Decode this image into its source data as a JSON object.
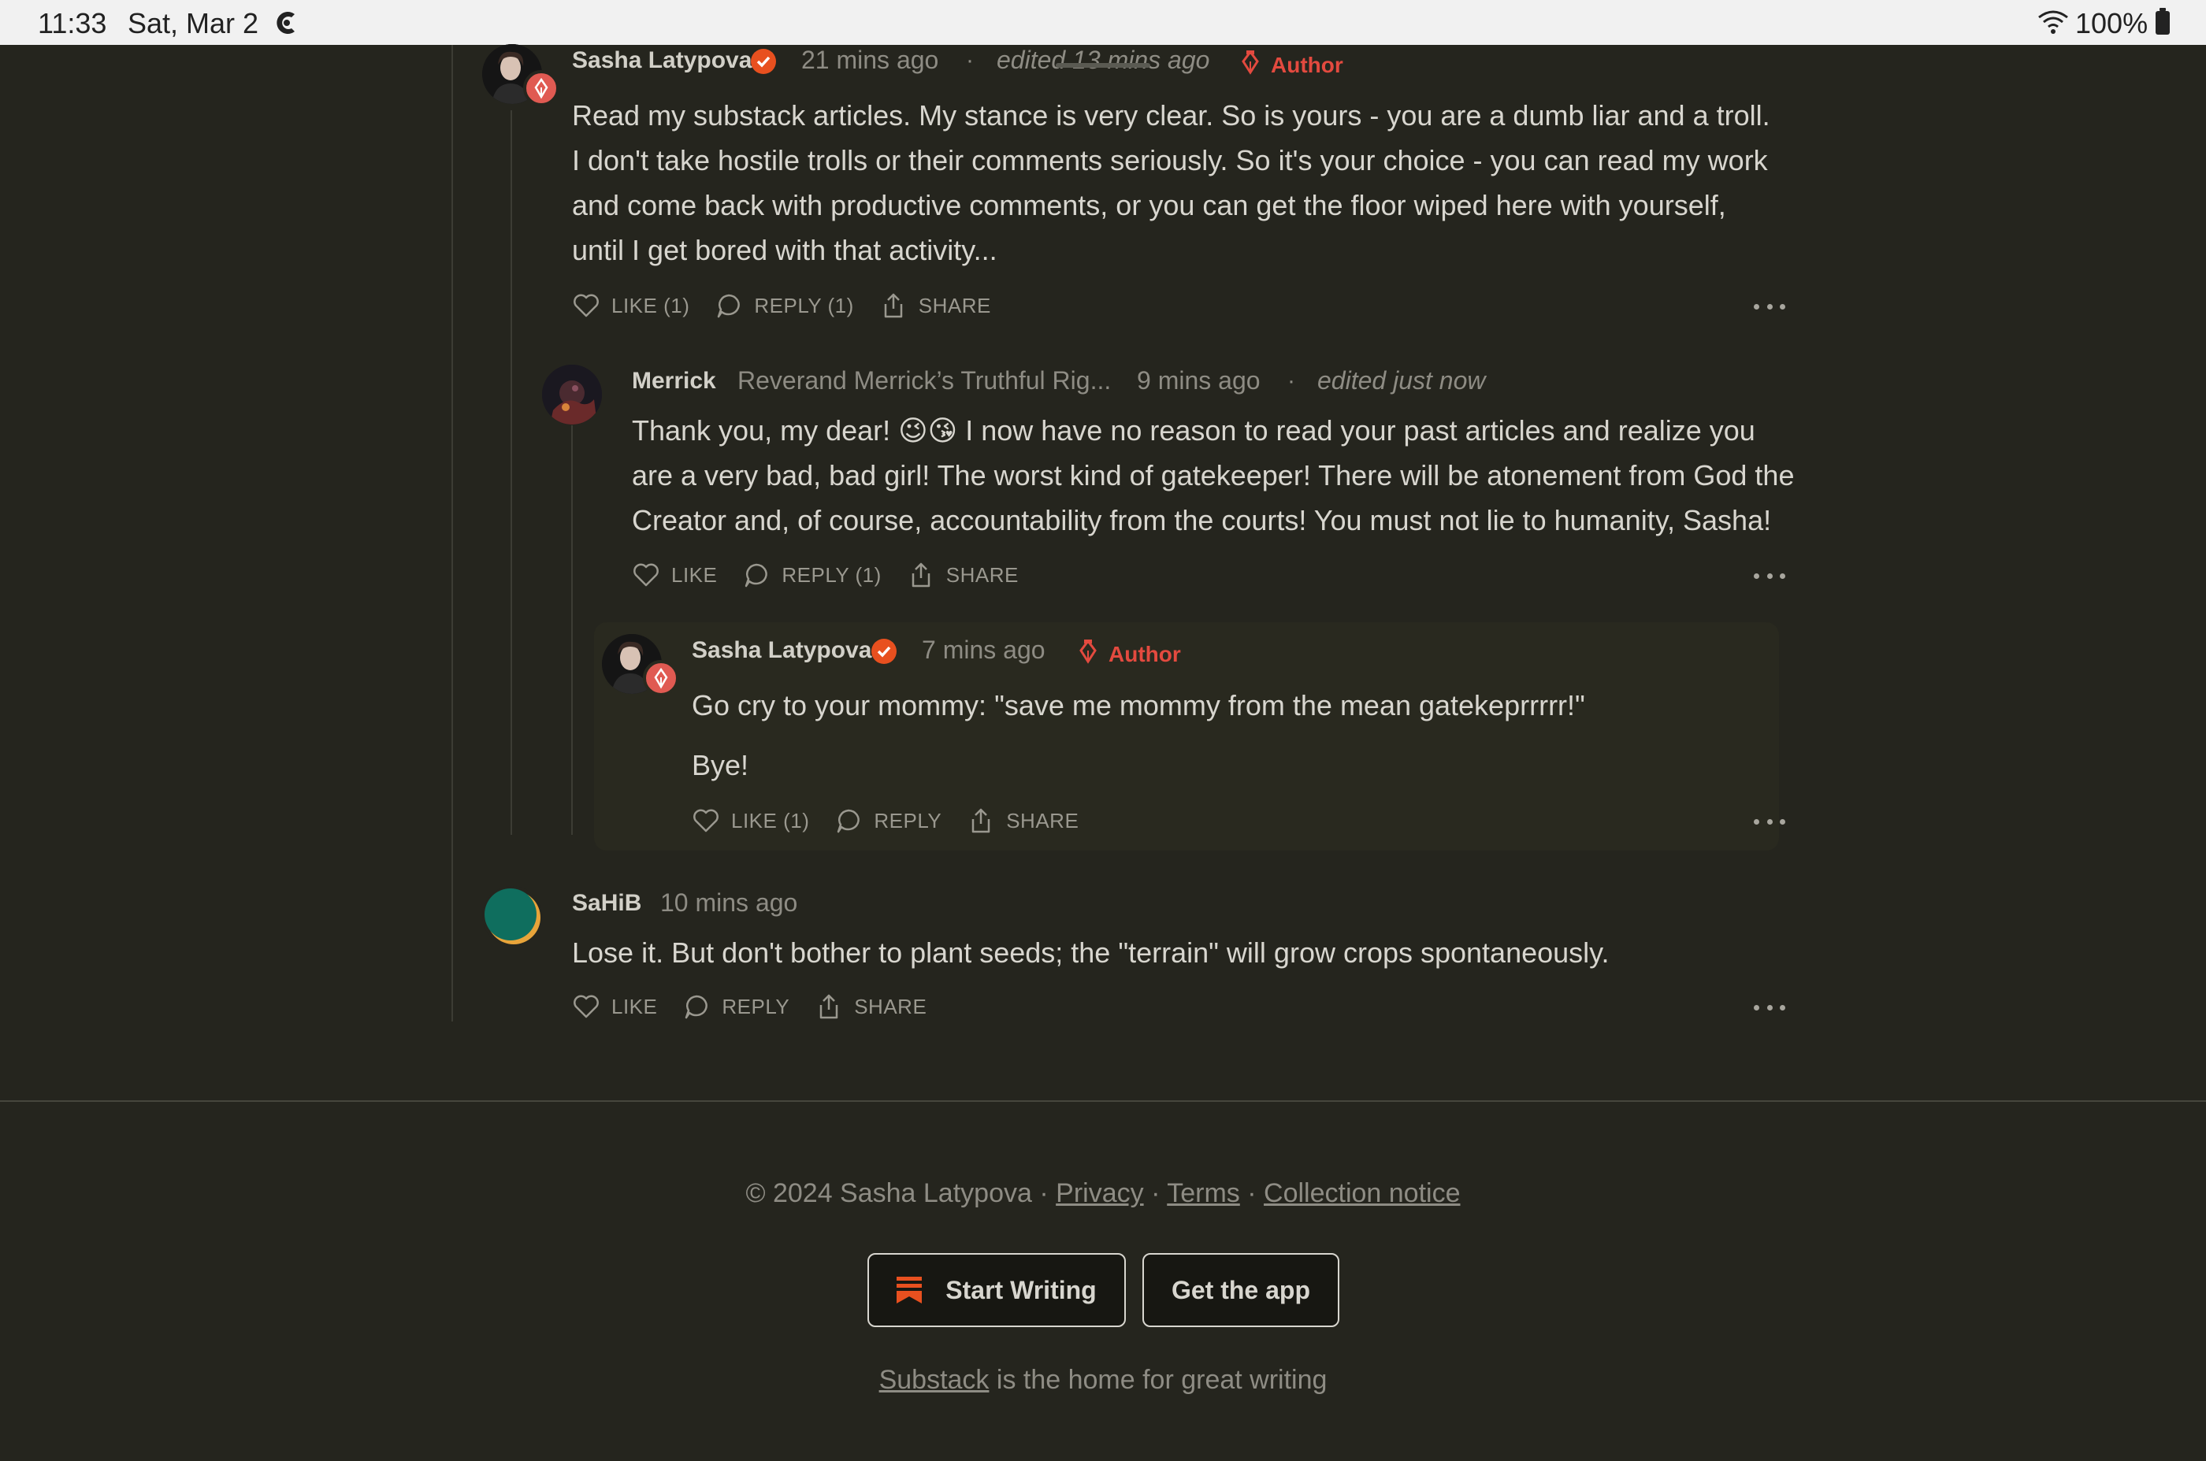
{
  "status_bar": {
    "time": "11:33",
    "date": "Sat, Mar 2",
    "battery": "100%"
  },
  "comments": [
    {
      "author": "Sasha Latypova",
      "time_ago": "21 mins ago",
      "edited": "edited 13 mins ago",
      "role": "Author",
      "text": "Read my substack articles. My stance is very clear. So is yours - you are a dumb liar and a troll. I don't take hostile trolls or their comments seriously. So it's your choice - you can read my work and come back with productive comments, or you can get the floor wiped here with yourself, until I get bored with that activity...",
      "like": "LIKE (1)",
      "reply": "REPLY (1)",
      "share": "SHARE"
    },
    {
      "author": "Merrick",
      "publication": "Reverand Merrick’s Truthful Rig...",
      "time_ago": "9 mins ago",
      "edited": "edited just now",
      "text": "Thank you, my dear! 😉😘 I now have no reason to read your past articles and realize you are a very bad, bad girl! The worst kind of gatekeeper! There will be atonement from God the Creator and, of course, accountability from the courts! You must not lie to humanity, Sasha!",
      "like": "LIKE",
      "reply": "REPLY (1)",
      "share": "SHARE"
    },
    {
      "author": "Sasha Latypova",
      "time_ago": "7 mins ago",
      "role": "Author",
      "text_line1": "Go cry to your mommy: \"save me mommy from the mean gatekeprrrrr!\"",
      "text_line2": "Bye!",
      "like": "LIKE (1)",
      "reply": "REPLY",
      "share": "SHARE"
    },
    {
      "author": "SaHiB",
      "time_ago": "10 mins ago",
      "text": "Lose it. But don't bother to plant seeds; the \"terrain\" will grow crops spontaneously.",
      "like": "LIKE",
      "reply": "REPLY",
      "share": "SHARE"
    }
  ],
  "footer": {
    "copyright": "© 2024 Sasha Latypova",
    "sep": "·",
    "privacy": "Privacy",
    "terms": "Terms",
    "collection": "Collection notice",
    "start_writing": "Start Writing",
    "get_app": "Get the app",
    "substack_link": "Substack",
    "tagline_rest": " is the home for great writing"
  },
  "colors": {
    "background": "#25251e",
    "author_accent": "#e34a3f",
    "verified": "#e8501f"
  },
  "icons": [
    "heart-icon",
    "comment-icon",
    "share-icon",
    "more-icon",
    "verified-icon",
    "quill-icon",
    "bookmark-icon",
    "wifi-icon"
  ]
}
